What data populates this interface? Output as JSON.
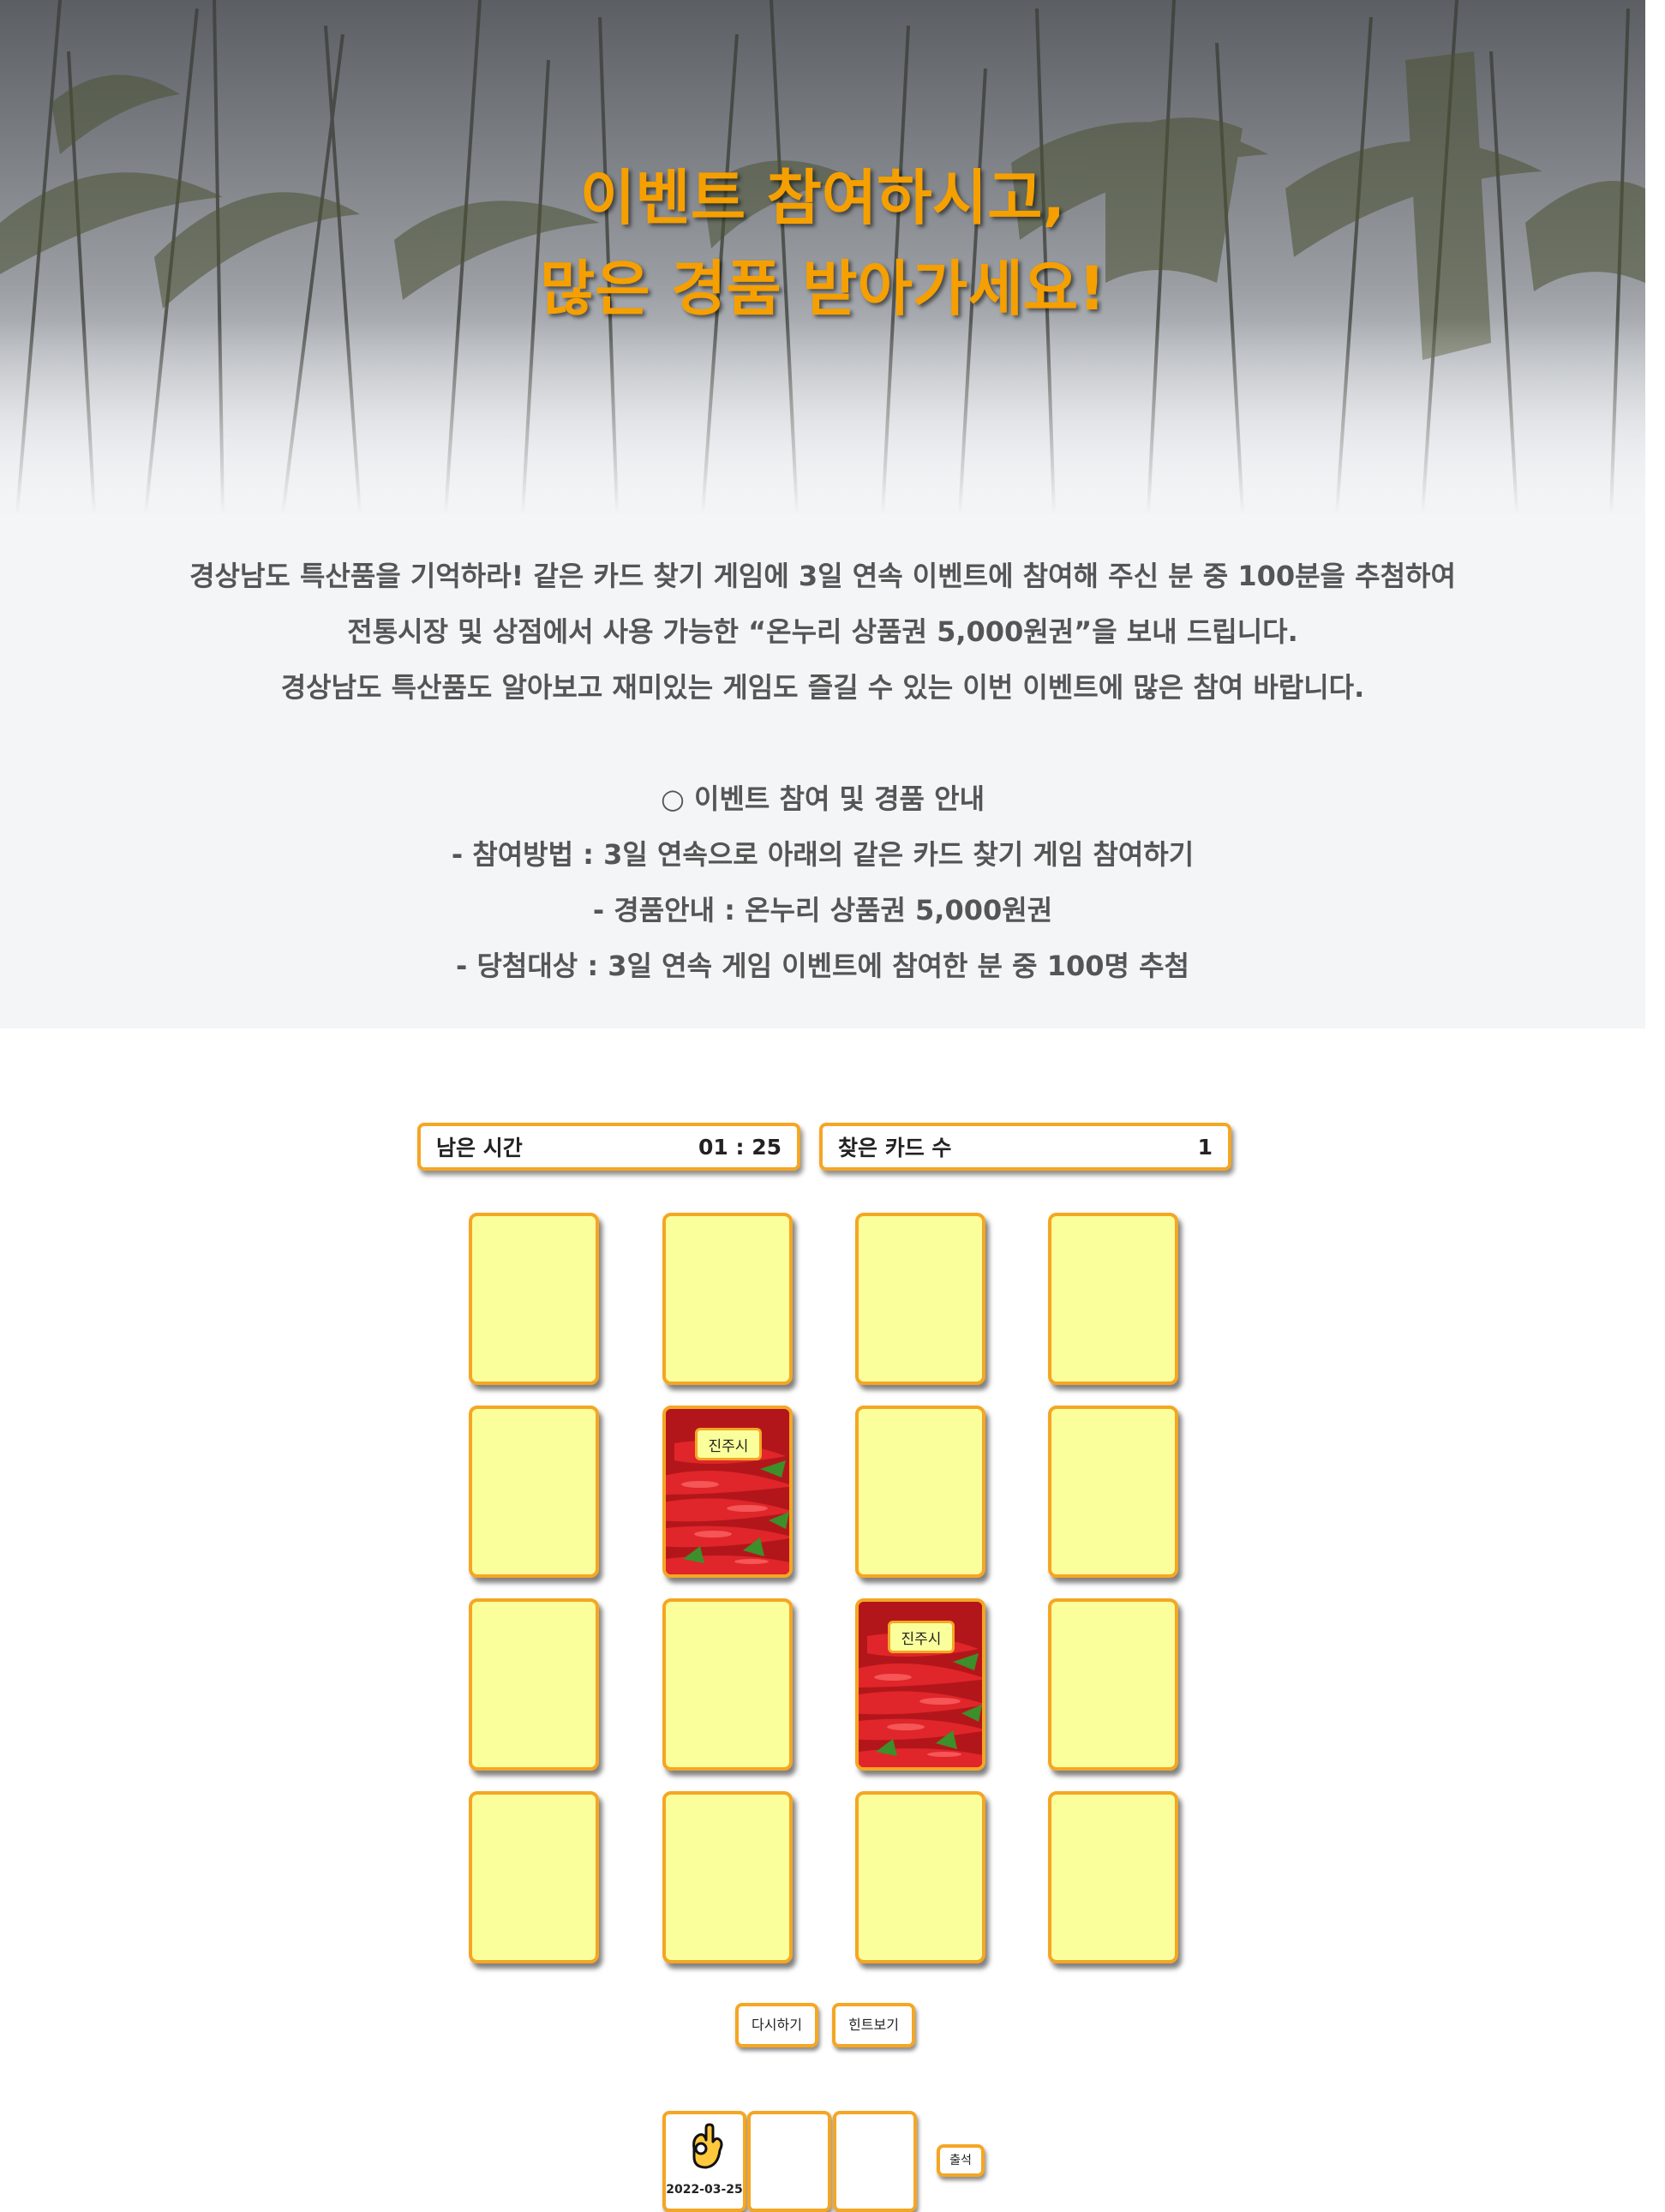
{
  "hero": {
    "title_line1": "이벤트 참여하시고,",
    "title_line2": "많은 경품 받아가세요!"
  },
  "intro": {
    "line1": "경상남도 특산품을 기억하라! 같은 카드 찾기 게임에 3일 연속 이벤트에 참여해 주신 분 중 100분을 추첨하여",
    "line2": "전통시장 및 상점에서 사용 가능한 “온누리 상품권 5,000원권”을 보내 드립니다.",
    "line3": "경상남도 특산품도 알아보고 재미있는 게임도 즐길 수 있는 이번 이벤트에 많은 참여 바랍니다."
  },
  "guide": {
    "heading": "○ 이벤트 참여 및 경품 안내",
    "method": "- 참여방법 : 3일 연속으로 아래의 같은 카드 찾기 게임 참여하기",
    "prize": "- 경품안내 : 온누리 상품권 5,000원권",
    "target": "- 당첨대상 : 3일 연속 게임 이벤트에 참여한 분 중 100명 추첨"
  },
  "status": {
    "time_label": "남은 시간",
    "time_value": "01 : 25",
    "found_label": "찾은 카드 수",
    "found_value": "1"
  },
  "cards": {
    "r1c1": {
      "state": "hidden"
    },
    "r1c2": {
      "state": "hidden"
    },
    "r1c3": {
      "state": "hidden"
    },
    "r1c4": {
      "state": "hidden"
    },
    "r2c1": {
      "state": "hidden"
    },
    "r2c2": {
      "state": "flipped",
      "label": "진주시",
      "image": "red-pepper"
    },
    "r2c3": {
      "state": "hidden"
    },
    "r2c4": {
      "state": "hidden"
    },
    "r3c1": {
      "state": "hidden"
    },
    "r3c2": {
      "state": "hidden"
    },
    "r3c3": {
      "state": "flipped",
      "label": "진주시",
      "image": "red-pepper"
    },
    "r3c4": {
      "state": "hidden"
    },
    "r4c1": {
      "state": "hidden"
    },
    "r4c2": {
      "state": "hidden"
    },
    "r4c3": {
      "state": "hidden"
    },
    "r4c4": {
      "state": "hidden"
    }
  },
  "buttons": {
    "retry": "다시하기",
    "hint": "힌트보기",
    "attend": "출석"
  },
  "attendance": {
    "slot1": {
      "icon": "ok-hand-icon",
      "date": "2022-03-25"
    },
    "slot2": {
      "date": ""
    },
    "slot3": {
      "date": ""
    }
  },
  "colors": {
    "accent": "#f5a623",
    "title": "#f5a000",
    "card_back": "#faff9c",
    "info_bg": "#f4f5f7"
  }
}
